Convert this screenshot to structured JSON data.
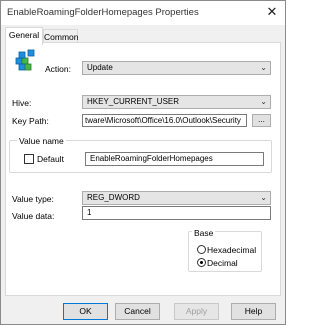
{
  "window": {
    "title": "EnableRoamingFolderHomepages Properties",
    "close_glyph": "✕"
  },
  "tabs": [
    {
      "label": "General"
    },
    {
      "label": "Common"
    }
  ],
  "action": {
    "label": "Action:",
    "value": "Update"
  },
  "hive": {
    "label": "Hive:",
    "value": "HKEY_CURRENT_USER"
  },
  "key_path": {
    "label": "Key Path:",
    "value": "tware\\Microsoft\\Office\\16.0\\Outlook\\Security",
    "browse_label": "..."
  },
  "value_name": {
    "group_label": "Value name",
    "default_label": "Default",
    "default_checked": false,
    "value": "EnableRoamingFolderHomepages"
  },
  "value_type": {
    "label": "Value type:",
    "value": "REG_DWORD"
  },
  "value_data": {
    "label": "Value data:",
    "value": "1"
  },
  "base": {
    "group_label": "Base",
    "options": [
      {
        "label": "Hexadecimal",
        "checked": false
      },
      {
        "label": "Decimal",
        "checked": true
      }
    ]
  },
  "buttons": {
    "ok": "OK",
    "cancel": "Cancel",
    "apply": "Apply",
    "help": "Help"
  },
  "icons": {
    "registry": "registry-cubes-icon",
    "combo": "chevron-down-icon"
  },
  "colors": {
    "accent": "#0078d7",
    "icon_blue": "#1e8ee0",
    "icon_green": "#45b649"
  }
}
